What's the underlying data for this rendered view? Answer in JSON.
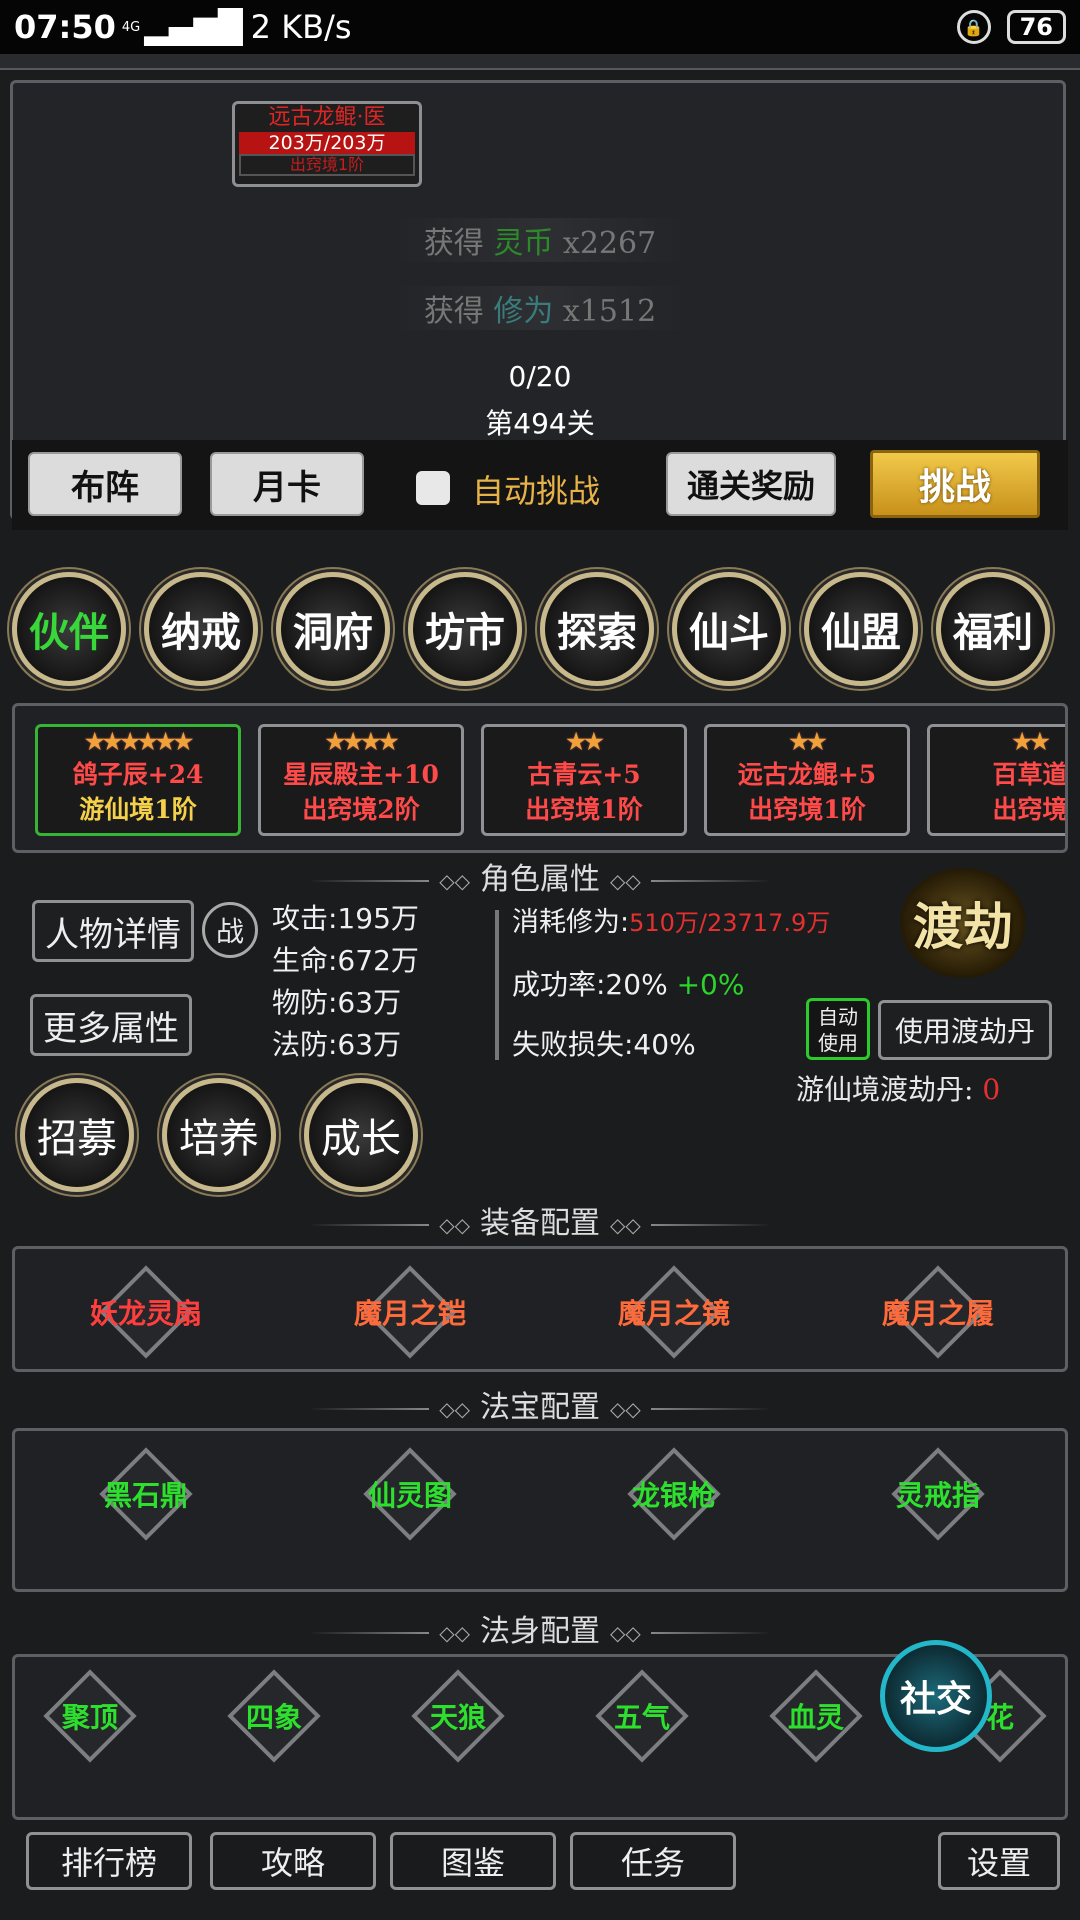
{
  "status_bar": {
    "time": "07:50",
    "network": "4G",
    "rate": "2 KB/s",
    "battery": "76"
  },
  "battle": {
    "enemy": {
      "name": "远古龙鲲·医",
      "hp": "203万/203万",
      "level": "出窍境1阶"
    },
    "gains": [
      {
        "prefix": "获得",
        "item": "灵币",
        "amount": "x2267"
      },
      {
        "prefix": "获得",
        "item": "修为",
        "amount": "x1512"
      }
    ],
    "wave": "0/20",
    "stage": "第494关",
    "buttons": {
      "formation": "布阵",
      "monthly": "月卡",
      "auto_challenge": "自动挑战",
      "clear_reward": "通关奖励",
      "challenge": "挑战"
    }
  },
  "menu": [
    "伙伴",
    "纳戒",
    "洞府",
    "坊市",
    "探索",
    "仙斗",
    "仙盟",
    "福利"
  ],
  "partners": [
    {
      "stars": "★★★★★★",
      "name": "鸽子辰+24",
      "realm": "游仙境1阶"
    },
    {
      "stars": "★★★★",
      "name": "星辰殿主+10",
      "realm": "出窍境2阶"
    },
    {
      "stars": "★★",
      "name": "古青云+5",
      "realm": "出窍境1阶"
    },
    {
      "stars": "★★",
      "name": "远古龙鲲+5",
      "realm": "出窍境1阶"
    },
    {
      "stars": "★★",
      "name": "百草道",
      "realm": "出窍境"
    }
  ],
  "attributes": {
    "title": "角色属性",
    "detail_btn": "人物详情",
    "battle_btn": "战",
    "more_btn": "更多属性",
    "stats": [
      "攻击:195万",
      "生命:672万",
      "物防:63万",
      "法防:63万"
    ],
    "consume_label": "消耗修为:",
    "consume_value": "510万/23717.9万",
    "success_label": "成功率:20%",
    "success_bonus": "+0%",
    "fail_label": "失败损失:40%",
    "dujie": "渡劫",
    "auto_use": "自动使用",
    "use_pill": "使用渡劫丹",
    "pill_label": "游仙境渡劫丹:",
    "pill_count": "0",
    "actions": [
      "招募",
      "培养",
      "成长"
    ]
  },
  "equipment": {
    "title": "装备配置",
    "items": [
      "妖龙灵扇",
      "魔月之铠",
      "魔月之镜",
      "魔月之履"
    ]
  },
  "treasure": {
    "title": "法宝配置",
    "items": [
      "黑石鼎",
      "仙灵图",
      "龙银枪",
      "灵戒指"
    ]
  },
  "dharma": {
    "title": "法身配置",
    "items": [
      "聚顶",
      "四象",
      "天狼",
      "五气",
      "血灵",
      "花"
    ]
  },
  "social": "社交",
  "bottom": [
    "排行榜",
    "攻略",
    "图鉴",
    "任务",
    "设置"
  ]
}
